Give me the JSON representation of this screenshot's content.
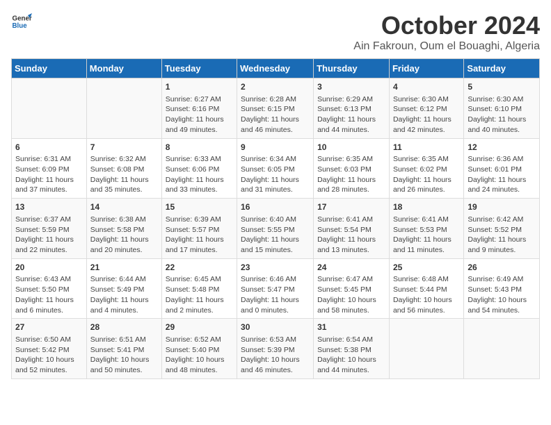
{
  "header": {
    "logo_general": "General",
    "logo_blue": "Blue",
    "title": "October 2024",
    "subtitle": "Ain Fakroun, Oum el Bouaghi, Algeria"
  },
  "columns": [
    "Sunday",
    "Monday",
    "Tuesday",
    "Wednesday",
    "Thursday",
    "Friday",
    "Saturday"
  ],
  "weeks": [
    [
      {
        "day": "",
        "info": ""
      },
      {
        "day": "",
        "info": ""
      },
      {
        "day": "1",
        "info": "Sunrise: 6:27 AM\nSunset: 6:16 PM\nDaylight: 11 hours and 49 minutes."
      },
      {
        "day": "2",
        "info": "Sunrise: 6:28 AM\nSunset: 6:15 PM\nDaylight: 11 hours and 46 minutes."
      },
      {
        "day": "3",
        "info": "Sunrise: 6:29 AM\nSunset: 6:13 PM\nDaylight: 11 hours and 44 minutes."
      },
      {
        "day": "4",
        "info": "Sunrise: 6:30 AM\nSunset: 6:12 PM\nDaylight: 11 hours and 42 minutes."
      },
      {
        "day": "5",
        "info": "Sunrise: 6:30 AM\nSunset: 6:10 PM\nDaylight: 11 hours and 40 minutes."
      }
    ],
    [
      {
        "day": "6",
        "info": "Sunrise: 6:31 AM\nSunset: 6:09 PM\nDaylight: 11 hours and 37 minutes."
      },
      {
        "day": "7",
        "info": "Sunrise: 6:32 AM\nSunset: 6:08 PM\nDaylight: 11 hours and 35 minutes."
      },
      {
        "day": "8",
        "info": "Sunrise: 6:33 AM\nSunset: 6:06 PM\nDaylight: 11 hours and 33 minutes."
      },
      {
        "day": "9",
        "info": "Sunrise: 6:34 AM\nSunset: 6:05 PM\nDaylight: 11 hours and 31 minutes."
      },
      {
        "day": "10",
        "info": "Sunrise: 6:35 AM\nSunset: 6:03 PM\nDaylight: 11 hours and 28 minutes."
      },
      {
        "day": "11",
        "info": "Sunrise: 6:35 AM\nSunset: 6:02 PM\nDaylight: 11 hours and 26 minutes."
      },
      {
        "day": "12",
        "info": "Sunrise: 6:36 AM\nSunset: 6:01 PM\nDaylight: 11 hours and 24 minutes."
      }
    ],
    [
      {
        "day": "13",
        "info": "Sunrise: 6:37 AM\nSunset: 5:59 PM\nDaylight: 11 hours and 22 minutes."
      },
      {
        "day": "14",
        "info": "Sunrise: 6:38 AM\nSunset: 5:58 PM\nDaylight: 11 hours and 20 minutes."
      },
      {
        "day": "15",
        "info": "Sunrise: 6:39 AM\nSunset: 5:57 PM\nDaylight: 11 hours and 17 minutes."
      },
      {
        "day": "16",
        "info": "Sunrise: 6:40 AM\nSunset: 5:55 PM\nDaylight: 11 hours and 15 minutes."
      },
      {
        "day": "17",
        "info": "Sunrise: 6:41 AM\nSunset: 5:54 PM\nDaylight: 11 hours and 13 minutes."
      },
      {
        "day": "18",
        "info": "Sunrise: 6:41 AM\nSunset: 5:53 PM\nDaylight: 11 hours and 11 minutes."
      },
      {
        "day": "19",
        "info": "Sunrise: 6:42 AM\nSunset: 5:52 PM\nDaylight: 11 hours and 9 minutes."
      }
    ],
    [
      {
        "day": "20",
        "info": "Sunrise: 6:43 AM\nSunset: 5:50 PM\nDaylight: 11 hours and 6 minutes."
      },
      {
        "day": "21",
        "info": "Sunrise: 6:44 AM\nSunset: 5:49 PM\nDaylight: 11 hours and 4 minutes."
      },
      {
        "day": "22",
        "info": "Sunrise: 6:45 AM\nSunset: 5:48 PM\nDaylight: 11 hours and 2 minutes."
      },
      {
        "day": "23",
        "info": "Sunrise: 6:46 AM\nSunset: 5:47 PM\nDaylight: 11 hours and 0 minutes."
      },
      {
        "day": "24",
        "info": "Sunrise: 6:47 AM\nSunset: 5:45 PM\nDaylight: 10 hours and 58 minutes."
      },
      {
        "day": "25",
        "info": "Sunrise: 6:48 AM\nSunset: 5:44 PM\nDaylight: 10 hours and 56 minutes."
      },
      {
        "day": "26",
        "info": "Sunrise: 6:49 AM\nSunset: 5:43 PM\nDaylight: 10 hours and 54 minutes."
      }
    ],
    [
      {
        "day": "27",
        "info": "Sunrise: 6:50 AM\nSunset: 5:42 PM\nDaylight: 10 hours and 52 minutes."
      },
      {
        "day": "28",
        "info": "Sunrise: 6:51 AM\nSunset: 5:41 PM\nDaylight: 10 hours and 50 minutes."
      },
      {
        "day": "29",
        "info": "Sunrise: 6:52 AM\nSunset: 5:40 PM\nDaylight: 10 hours and 48 minutes."
      },
      {
        "day": "30",
        "info": "Sunrise: 6:53 AM\nSunset: 5:39 PM\nDaylight: 10 hours and 46 minutes."
      },
      {
        "day": "31",
        "info": "Sunrise: 6:54 AM\nSunset: 5:38 PM\nDaylight: 10 hours and 44 minutes."
      },
      {
        "day": "",
        "info": ""
      },
      {
        "day": "",
        "info": ""
      }
    ]
  ]
}
